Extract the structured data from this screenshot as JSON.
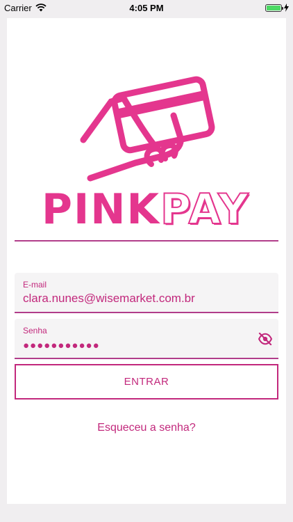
{
  "status_bar": {
    "carrier": "Carrier",
    "time": "4:05 PM"
  },
  "logo": {
    "word_pink": "PINK",
    "word_pay": "PAY",
    "icon": "hand-card-icon",
    "color": "#e4368e"
  },
  "form": {
    "email_label": "E-mail",
    "email_value": "clara.nunes@wisemarket.com.br",
    "password_label": "Senha",
    "password_value": "●●●●●●●●●●●",
    "password_toggle_icon": "eye-off-icon"
  },
  "actions": {
    "submit_label": "ENTRAR",
    "forgot_label": "Esqueceu a senha?"
  },
  "colors": {
    "accent": "#c2287c",
    "divider": "#b13d8a",
    "battery": "#4cd964"
  }
}
